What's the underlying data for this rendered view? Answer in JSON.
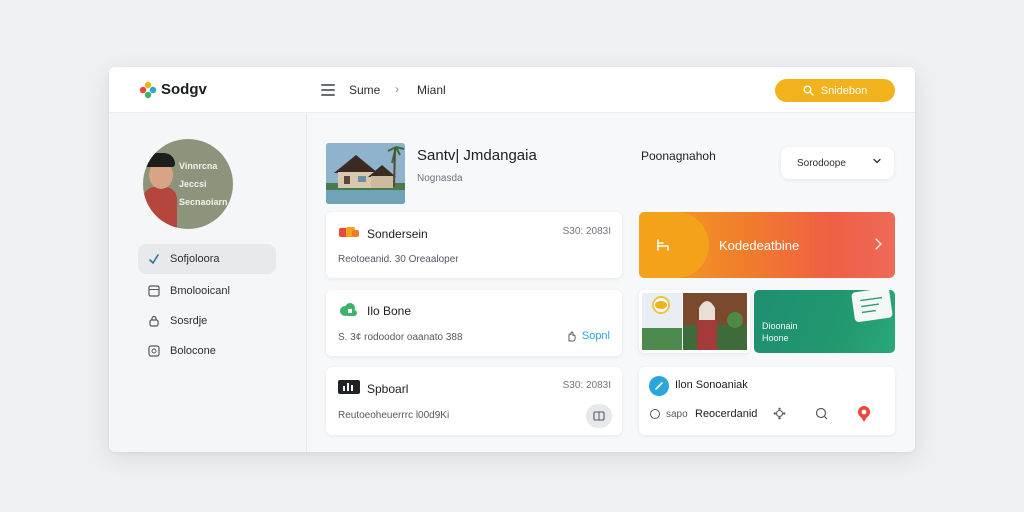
{
  "app": {
    "name": "Sodgv"
  },
  "profile": {
    "lines": [
      "Vinnrcna",
      "Jeccsi",
      "Secnaoiarn"
    ]
  },
  "sidebar": {
    "items": [
      {
        "label": "Sofjoloora",
        "icon": "check-icon",
        "active": true
      },
      {
        "label": "Bmolooicanl",
        "icon": "square-icon",
        "active": false
      },
      {
        "label": "Sosrdje",
        "icon": "lock-icon",
        "active": false
      },
      {
        "label": "Bolocone",
        "icon": "box-icon",
        "active": false
      }
    ]
  },
  "topbar": {
    "breadcrumb": [
      "Sume",
      "Mianl"
    ],
    "separator": "›",
    "search_label": "Snidebon"
  },
  "hero": {
    "title": "Santv| Jmdangaia",
    "subtitle": "Nognasda"
  },
  "right_panel": {
    "title": "Poonagnahoh",
    "dropdown_value": "Sorodoope"
  },
  "cards": [
    {
      "title": "Sondersein",
      "meta": "S30: 2083I",
      "desc": "Reotoeanid. 30 Oreaaloper",
      "icon": "puzzle-icon"
    },
    {
      "title": "Ilo Bone",
      "meta": "",
      "desc": "S. 3¢ rodoodor oaanato 388",
      "action": "Sopnl",
      "icon": "cloud-icon"
    },
    {
      "title": "Spboarl",
      "meta": "S30: 2083I",
      "desc": "Reutoeoheuerrrc l00d9Ki",
      "icon": "chart-icon"
    }
  ],
  "feature": {
    "label": "Kodedeatbine"
  },
  "green_tile": {
    "line1": "Dioonain",
    "line2": "Hoone"
  },
  "bottom": {
    "title": "Ilon Sonoaniak",
    "sub_label": "sapo",
    "action_label": "Reocerdanid"
  },
  "colors": {
    "accent": "#f2b21c",
    "orange": "#f07a2e",
    "green": "#21986f",
    "blue": "#2aa6d8"
  }
}
